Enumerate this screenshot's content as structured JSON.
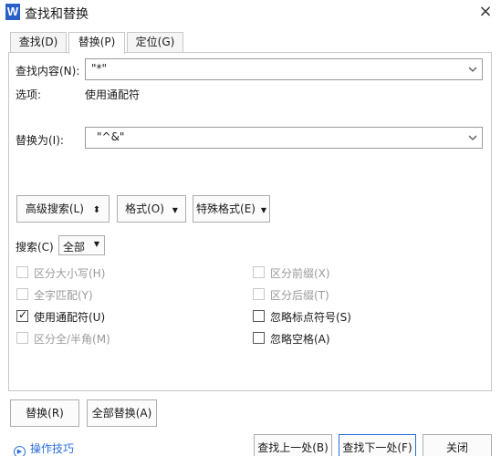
{
  "window": {
    "app_icon_letter": "W",
    "title": "查找和替换",
    "close_glyph": "×"
  },
  "tabs": [
    {
      "label": "查找(D)"
    },
    {
      "label": "替换(P)"
    },
    {
      "label": "定位(G)"
    }
  ],
  "find": {
    "label": "查找内容(N):",
    "value": "\"*\""
  },
  "options": {
    "label": "选项:",
    "value": "使用通配符"
  },
  "replace": {
    "label": "替换为(I):",
    "value": "\"^&\""
  },
  "toolbar": {
    "advanced_search": "高级搜索(L)",
    "advanced_glyph": "⬍",
    "format": "格式(O)",
    "special_format": "特殊格式(E)"
  },
  "search_scope": {
    "label": "搜索(C)",
    "value": "全部"
  },
  "checkboxes": {
    "match_case": {
      "label": "区分大小写(H)",
      "checked": false,
      "enabled": false
    },
    "whole_word": {
      "label": "全字匹配(Y)",
      "checked": false,
      "enabled": false
    },
    "use_wildcards": {
      "label": "使用通配符(U)",
      "checked": true,
      "enabled": true
    },
    "full_half_width": {
      "label": "区分全/半角(M)",
      "checked": false,
      "enabled": false
    },
    "match_prefix": {
      "label": "区分前缀(X)",
      "checked": false,
      "enabled": false
    },
    "match_suffix": {
      "label": "区分后缀(T)",
      "checked": false,
      "enabled": false
    },
    "ignore_punct": {
      "label": "忽略标点符号(S)",
      "checked": false,
      "enabled": true
    },
    "ignore_space": {
      "label": "忽略空格(A)",
      "checked": false,
      "enabled": true
    }
  },
  "buttons": {
    "replace": "替换(R)",
    "replace_all": "全部替换(A)",
    "find_prev": "查找上一处(B)",
    "find_next": "查找下一处(F)",
    "close": "关闭"
  },
  "help": {
    "label": "操作技巧",
    "icon_glyph": "▶"
  }
}
